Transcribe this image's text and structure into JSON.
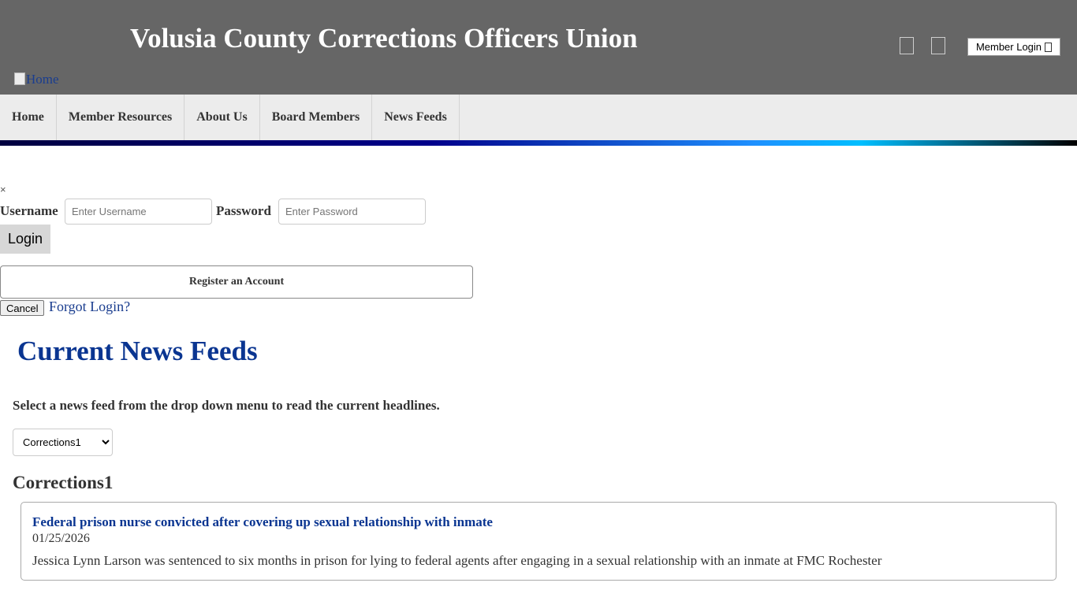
{
  "header": {
    "site_title": "Volusia County Corrections Officers Union",
    "home_logo_alt": "Home",
    "member_login_label": "Member Login"
  },
  "nav": {
    "items": [
      {
        "label": "Home"
      },
      {
        "label": "Member Resources"
      },
      {
        "label": "About Us"
      },
      {
        "label": "Board Members"
      },
      {
        "label": "News Feeds"
      }
    ]
  },
  "login_form": {
    "close_symbol": "×",
    "username_label": "Username",
    "username_placeholder": "Enter Username",
    "password_label": "Password",
    "password_placeholder": "Enter Password",
    "login_button": "Login",
    "register_button": "Register an Account",
    "cancel_button": "Cancel",
    "forgot_link": "Forgot Login?"
  },
  "main": {
    "title": "Current News Feeds",
    "instructions": "Select a news feed from the drop down menu to read the current headlines.",
    "feed_select": {
      "selected": "Corrections1"
    },
    "feed_name": "Corrections1",
    "articles": [
      {
        "title": "Federal prison nurse convicted after covering up sexual relationship with inmate",
        "date": "01/25/2026",
        "description": "Jessica Lynn Larson was sentenced to six months in prison for lying to federal agents after engaging in a sexual relationship with an inmate at FMC Rochester"
      }
    ]
  }
}
